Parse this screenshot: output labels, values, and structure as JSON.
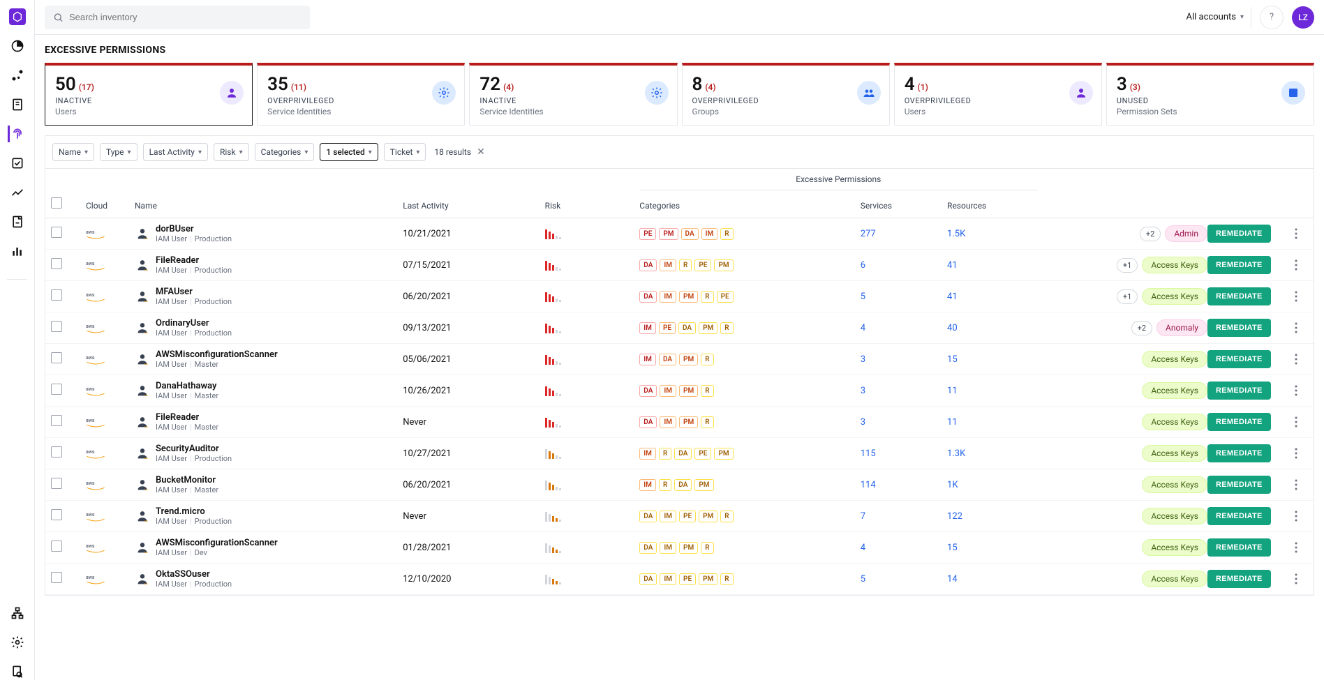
{
  "header": {
    "search_placeholder": "Search inventory",
    "accounts_label": "All accounts",
    "avatar_initials": "LZ"
  },
  "page": {
    "title": "EXCESSIVE PERMISSIONS",
    "results_label": "18 results"
  },
  "cards": [
    {
      "count": "50",
      "delta": "(17)",
      "label": "INACTIVE",
      "sub": "Users",
      "icon": "user",
      "tint": "purple"
    },
    {
      "count": "35",
      "delta": "(11)",
      "label": "OVERPRIVILEGED",
      "sub": "Service Identities",
      "icon": "gear",
      "tint": "blue"
    },
    {
      "count": "72",
      "delta": "(4)",
      "label": "INACTIVE",
      "sub": "Service Identities",
      "icon": "gear",
      "tint": "blue"
    },
    {
      "count": "8",
      "delta": "(4)",
      "label": "OVERPRIVILEGED",
      "sub": "Groups",
      "icon": "group",
      "tint": "blue"
    },
    {
      "count": "4",
      "delta": "(1)",
      "label": "OVERPRIVILEGED",
      "sub": "Users",
      "icon": "user",
      "tint": "purple"
    },
    {
      "count": "3",
      "delta": "(3)",
      "label": "UNUSED",
      "sub": "Permission Sets",
      "icon": "perm",
      "tint": "blue"
    }
  ],
  "filters": [
    {
      "label": "Name",
      "strong": false
    },
    {
      "label": "Type",
      "strong": false
    },
    {
      "label": "Last Activity",
      "strong": false
    },
    {
      "label": "Risk",
      "strong": false
    },
    {
      "label": "Categories",
      "strong": false
    },
    {
      "label": "1 selected",
      "strong": true
    },
    {
      "label": "Ticket",
      "strong": false
    }
  ],
  "table": {
    "group_header": "Excessive Permissions",
    "columns": {
      "cloud": "Cloud",
      "name": "Name",
      "last": "Last Activity",
      "risk": "Risk",
      "categories": "Categories",
      "services": "Services",
      "resources": "Resources"
    },
    "remediate_label": "REMEDIATE",
    "rows": [
      {
        "name": "dorBUser",
        "role": "IAM User",
        "env": "Production",
        "last": "10/21/2021",
        "risk": "high",
        "cats": [
          {
            "t": "PE",
            "c": "red"
          },
          {
            "t": "PM",
            "c": "red"
          },
          {
            "t": "DA",
            "c": "orange"
          },
          {
            "t": "IM",
            "c": "orange"
          },
          {
            "t": "R",
            "c": "yellow"
          }
        ],
        "services": "277",
        "resources": "1.5K",
        "tags": [
          {
            "t": "+2",
            "k": "plus"
          },
          {
            "t": "Admin",
            "k": "pink"
          }
        ]
      },
      {
        "name": "FileReader",
        "role": "IAM User",
        "env": "Production",
        "last": "07/15/2021",
        "risk": "high",
        "cats": [
          {
            "t": "DA",
            "c": "red"
          },
          {
            "t": "IM",
            "c": "orange"
          },
          {
            "t": "R",
            "c": "yellow"
          },
          {
            "t": "PE",
            "c": "yellow"
          },
          {
            "t": "PM",
            "c": "yellow"
          }
        ],
        "services": "6",
        "resources": "41",
        "tags": [
          {
            "t": "+1",
            "k": "plus"
          },
          {
            "t": "Access Keys",
            "k": "lime"
          }
        ]
      },
      {
        "name": "MFAUser",
        "role": "IAM User",
        "env": "Production",
        "last": "06/20/2021",
        "risk": "high",
        "cats": [
          {
            "t": "DA",
            "c": "red"
          },
          {
            "t": "IM",
            "c": "orange"
          },
          {
            "t": "PM",
            "c": "orange"
          },
          {
            "t": "R",
            "c": "yellow"
          },
          {
            "t": "PE",
            "c": "yellow"
          }
        ],
        "services": "5",
        "resources": "41",
        "tags": [
          {
            "t": "+1",
            "k": "plus"
          },
          {
            "t": "Access Keys",
            "k": "lime"
          }
        ]
      },
      {
        "name": "OrdinaryUser",
        "role": "IAM User",
        "env": "Production",
        "last": "09/13/2021",
        "risk": "high",
        "cats": [
          {
            "t": "IM",
            "c": "red"
          },
          {
            "t": "PE",
            "c": "orange"
          },
          {
            "t": "DA",
            "c": "yellow"
          },
          {
            "t": "PM",
            "c": "yellow"
          },
          {
            "t": "R",
            "c": "yellow"
          }
        ],
        "services": "4",
        "resources": "40",
        "tags": [
          {
            "t": "+2",
            "k": "plus"
          },
          {
            "t": "Anomaly",
            "k": "pink"
          }
        ]
      },
      {
        "name": "AWSMisconfigurationScanner",
        "role": "IAM User",
        "env": "Master",
        "last": "05/06/2021",
        "risk": "high",
        "cats": [
          {
            "t": "IM",
            "c": "red"
          },
          {
            "t": "DA",
            "c": "orange"
          },
          {
            "t": "PM",
            "c": "orange"
          },
          {
            "t": "R",
            "c": "yellow"
          }
        ],
        "services": "3",
        "resources": "15",
        "tags": [
          {
            "t": "Access Keys",
            "k": "lime"
          }
        ]
      },
      {
        "name": "DanaHathaway",
        "role": "IAM User",
        "env": "Master",
        "last": "10/26/2021",
        "risk": "high",
        "cats": [
          {
            "t": "DA",
            "c": "red"
          },
          {
            "t": "IM",
            "c": "orange"
          },
          {
            "t": "PM",
            "c": "orange"
          },
          {
            "t": "R",
            "c": "yellow"
          }
        ],
        "services": "3",
        "resources": "11",
        "tags": [
          {
            "t": "Access Keys",
            "k": "lime"
          }
        ]
      },
      {
        "name": "FileReader",
        "role": "IAM User",
        "env": "Master",
        "last": "Never",
        "risk": "high",
        "cats": [
          {
            "t": "DA",
            "c": "red"
          },
          {
            "t": "IM",
            "c": "orange"
          },
          {
            "t": "PM",
            "c": "orange"
          },
          {
            "t": "R",
            "c": "yellow"
          }
        ],
        "services": "3",
        "resources": "11",
        "tags": [
          {
            "t": "Access Keys",
            "k": "lime"
          }
        ]
      },
      {
        "name": "SecurityAuditor",
        "role": "IAM User",
        "env": "Production",
        "last": "10/27/2021",
        "risk": "med",
        "cats": [
          {
            "t": "IM",
            "c": "orange"
          },
          {
            "t": "R",
            "c": "yellow"
          },
          {
            "t": "DA",
            "c": "yellow"
          },
          {
            "t": "PE",
            "c": "yellow"
          },
          {
            "t": "PM",
            "c": "yellow"
          }
        ],
        "services": "115",
        "resources": "1.3K",
        "tags": [
          {
            "t": "Access Keys",
            "k": "lime"
          }
        ]
      },
      {
        "name": "BucketMonitor",
        "role": "IAM User",
        "env": "Master",
        "last": "06/20/2021",
        "risk": "med",
        "cats": [
          {
            "t": "IM",
            "c": "orange"
          },
          {
            "t": "R",
            "c": "yellow"
          },
          {
            "t": "DA",
            "c": "yellow"
          },
          {
            "t": "PM",
            "c": "yellow"
          }
        ],
        "services": "114",
        "resources": "1K",
        "tags": [
          {
            "t": "Access Keys",
            "k": "lime"
          }
        ]
      },
      {
        "name": "Trend.micro",
        "role": "IAM User",
        "env": "Production",
        "last": "Never",
        "risk": "low",
        "cats": [
          {
            "t": "DA",
            "c": "yellow"
          },
          {
            "t": "IM",
            "c": "yellow"
          },
          {
            "t": "PE",
            "c": "yellow"
          },
          {
            "t": "PM",
            "c": "yellow"
          },
          {
            "t": "R",
            "c": "yellow"
          }
        ],
        "services": "7",
        "resources": "122",
        "tags": [
          {
            "t": "Access Keys",
            "k": "lime"
          }
        ]
      },
      {
        "name": "AWSMisconfigurationScanner",
        "role": "IAM User",
        "env": "Dev",
        "last": "01/28/2021",
        "risk": "low",
        "cats": [
          {
            "t": "DA",
            "c": "yellow"
          },
          {
            "t": "IM",
            "c": "yellow"
          },
          {
            "t": "PM",
            "c": "yellow"
          },
          {
            "t": "R",
            "c": "yellow"
          }
        ],
        "services": "4",
        "resources": "15",
        "tags": [
          {
            "t": "Access Keys",
            "k": "lime"
          }
        ]
      },
      {
        "name": "OktaSSOuser",
        "role": "IAM User",
        "env": "Production",
        "last": "12/10/2020",
        "risk": "low",
        "cats": [
          {
            "t": "DA",
            "c": "yellow"
          },
          {
            "t": "IM",
            "c": "yellow"
          },
          {
            "t": "PE",
            "c": "yellow"
          },
          {
            "t": "PM",
            "c": "yellow"
          },
          {
            "t": "R",
            "c": "yellow"
          }
        ],
        "services": "5",
        "resources": "14",
        "tags": [
          {
            "t": "Access Keys",
            "k": "lime"
          }
        ]
      }
    ]
  }
}
